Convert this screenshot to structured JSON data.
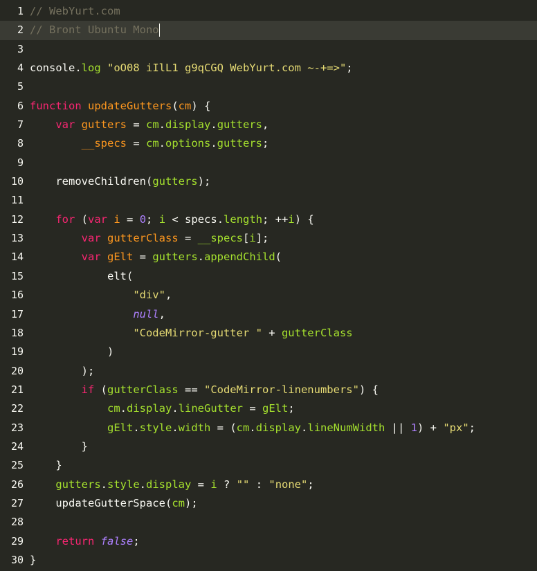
{
  "colors": {
    "background": "#272822",
    "active_line": "#3a3b34",
    "comment": "#75715e",
    "keyword": "#f92672",
    "string": "#e6db74",
    "def": "#fd971f",
    "variable": "#a6e22e",
    "number": "#ae81ff",
    "text": "#f8f8f2"
  },
  "editor": {
    "active_line": 2,
    "lines": [
      {
        "n": "1",
        "tokens": [
          [
            "comment",
            "// WebYurt.com"
          ]
        ]
      },
      {
        "n": "2",
        "tokens": [
          [
            "comment",
            "// Bront Ubuntu Mono"
          ]
        ],
        "cursor": true
      },
      {
        "n": "3",
        "tokens": []
      },
      {
        "n": "4",
        "tokens": [
          [
            "plain",
            "console."
          ],
          [
            "prop",
            "log"
          ],
          [
            "plain",
            " "
          ],
          [
            "string",
            "\"oO08 iIlL1 g9qCGQ WebYurt.com ~-+=>\""
          ],
          [
            "plain",
            ";"
          ]
        ]
      },
      {
        "n": "5",
        "tokens": []
      },
      {
        "n": "6",
        "tokens": [
          [
            "keyword",
            "function"
          ],
          [
            "plain",
            " "
          ],
          [
            "def",
            "updateGutters"
          ],
          [
            "plain",
            "("
          ],
          [
            "def",
            "cm"
          ],
          [
            "plain",
            ") {"
          ]
        ]
      },
      {
        "n": "7",
        "tokens": [
          [
            "plain",
            "    "
          ],
          [
            "keyword",
            "var"
          ],
          [
            "plain",
            " "
          ],
          [
            "def",
            "gutters"
          ],
          [
            "plain",
            " = "
          ],
          [
            "var",
            "cm"
          ],
          [
            "plain",
            "."
          ],
          [
            "prop",
            "display"
          ],
          [
            "plain",
            "."
          ],
          [
            "prop",
            "gutters"
          ],
          [
            "plain",
            ","
          ]
        ]
      },
      {
        "n": "8",
        "tokens": [
          [
            "plain",
            "        "
          ],
          [
            "def",
            "__specs"
          ],
          [
            "plain",
            " = "
          ],
          [
            "var",
            "cm"
          ],
          [
            "plain",
            "."
          ],
          [
            "prop",
            "options"
          ],
          [
            "plain",
            "."
          ],
          [
            "prop",
            "gutters"
          ],
          [
            "plain",
            ";"
          ]
        ]
      },
      {
        "n": "9",
        "tokens": []
      },
      {
        "n": "10",
        "tokens": [
          [
            "plain",
            "    removeChildren("
          ],
          [
            "var",
            "gutters"
          ],
          [
            "plain",
            ");"
          ]
        ]
      },
      {
        "n": "11",
        "tokens": []
      },
      {
        "n": "12",
        "tokens": [
          [
            "plain",
            "    "
          ],
          [
            "keyword",
            "for"
          ],
          [
            "plain",
            " ("
          ],
          [
            "keyword",
            "var"
          ],
          [
            "plain",
            " "
          ],
          [
            "def",
            "i"
          ],
          [
            "plain",
            " = "
          ],
          [
            "number",
            "0"
          ],
          [
            "plain",
            "; "
          ],
          [
            "var",
            "i"
          ],
          [
            "plain",
            " < specs."
          ],
          [
            "prop",
            "length"
          ],
          [
            "plain",
            "; ++"
          ],
          [
            "var",
            "i"
          ],
          [
            "plain",
            ") {"
          ]
        ]
      },
      {
        "n": "13",
        "tokens": [
          [
            "plain",
            "        "
          ],
          [
            "keyword",
            "var"
          ],
          [
            "plain",
            " "
          ],
          [
            "def",
            "gutterClass"
          ],
          [
            "plain",
            " = "
          ],
          [
            "var",
            "__specs"
          ],
          [
            "plain",
            "["
          ],
          [
            "var",
            "i"
          ],
          [
            "plain",
            "];"
          ]
        ]
      },
      {
        "n": "14",
        "tokens": [
          [
            "plain",
            "        "
          ],
          [
            "keyword",
            "var"
          ],
          [
            "plain",
            " "
          ],
          [
            "def",
            "gElt"
          ],
          [
            "plain",
            " = "
          ],
          [
            "var",
            "gutters"
          ],
          [
            "plain",
            "."
          ],
          [
            "prop",
            "appendChild"
          ],
          [
            "plain",
            "("
          ]
        ]
      },
      {
        "n": "15",
        "tokens": [
          [
            "plain",
            "            elt("
          ]
        ]
      },
      {
        "n": "16",
        "tokens": [
          [
            "plain",
            "                "
          ],
          [
            "string",
            "\"div\""
          ],
          [
            "plain",
            ","
          ]
        ]
      },
      {
        "n": "17",
        "tokens": [
          [
            "plain",
            "                "
          ],
          [
            "atom",
            "null"
          ],
          [
            "plain",
            ","
          ]
        ]
      },
      {
        "n": "18",
        "tokens": [
          [
            "plain",
            "                "
          ],
          [
            "string",
            "\"CodeMirror-gutter \""
          ],
          [
            "plain",
            " + "
          ],
          [
            "var",
            "gutterClass"
          ]
        ]
      },
      {
        "n": "19",
        "tokens": [
          [
            "plain",
            "            )"
          ]
        ]
      },
      {
        "n": "20",
        "tokens": [
          [
            "plain",
            "        );"
          ]
        ]
      },
      {
        "n": "21",
        "tokens": [
          [
            "plain",
            "        "
          ],
          [
            "keyword",
            "if"
          ],
          [
            "plain",
            " ("
          ],
          [
            "var",
            "gutterClass"
          ],
          [
            "plain",
            " == "
          ],
          [
            "string",
            "\"CodeMirror-linenumbers\""
          ],
          [
            "plain",
            ") {"
          ]
        ]
      },
      {
        "n": "22",
        "tokens": [
          [
            "plain",
            "            "
          ],
          [
            "var",
            "cm"
          ],
          [
            "plain",
            "."
          ],
          [
            "prop",
            "display"
          ],
          [
            "plain",
            "."
          ],
          [
            "prop",
            "lineGutter"
          ],
          [
            "plain",
            " = "
          ],
          [
            "var",
            "gElt"
          ],
          [
            "plain",
            ";"
          ]
        ]
      },
      {
        "n": "23",
        "tokens": [
          [
            "plain",
            "            "
          ],
          [
            "var",
            "gElt"
          ],
          [
            "plain",
            "."
          ],
          [
            "prop",
            "style"
          ],
          [
            "plain",
            "."
          ],
          [
            "prop",
            "width"
          ],
          [
            "plain",
            " = ("
          ],
          [
            "var",
            "cm"
          ],
          [
            "plain",
            "."
          ],
          [
            "prop",
            "display"
          ],
          [
            "plain",
            "."
          ],
          [
            "prop",
            "lineNumWidth"
          ],
          [
            "plain",
            " || "
          ],
          [
            "number",
            "1"
          ],
          [
            "plain",
            ") + "
          ],
          [
            "string",
            "\"px\""
          ],
          [
            "plain",
            ";"
          ]
        ]
      },
      {
        "n": "24",
        "tokens": [
          [
            "plain",
            "        }"
          ]
        ]
      },
      {
        "n": "25",
        "tokens": [
          [
            "plain",
            "    }"
          ]
        ]
      },
      {
        "n": "26",
        "tokens": [
          [
            "plain",
            "    "
          ],
          [
            "var",
            "gutters"
          ],
          [
            "plain",
            "."
          ],
          [
            "prop",
            "style"
          ],
          [
            "plain",
            "."
          ],
          [
            "prop",
            "display"
          ],
          [
            "plain",
            " = "
          ],
          [
            "var",
            "i"
          ],
          [
            "plain",
            " ? "
          ],
          [
            "string",
            "\"\""
          ],
          [
            "plain",
            " : "
          ],
          [
            "string",
            "\"none\""
          ],
          [
            "plain",
            ";"
          ]
        ]
      },
      {
        "n": "27",
        "tokens": [
          [
            "plain",
            "    updateGutterSpace("
          ],
          [
            "var",
            "cm"
          ],
          [
            "plain",
            ");"
          ]
        ]
      },
      {
        "n": "28",
        "tokens": []
      },
      {
        "n": "29",
        "tokens": [
          [
            "plain",
            "    "
          ],
          [
            "keyword",
            "return"
          ],
          [
            "plain",
            " "
          ],
          [
            "atom",
            "false"
          ],
          [
            "plain",
            ";"
          ]
        ]
      },
      {
        "n": "30",
        "tokens": [
          [
            "plain",
            "}"
          ]
        ]
      }
    ]
  }
}
